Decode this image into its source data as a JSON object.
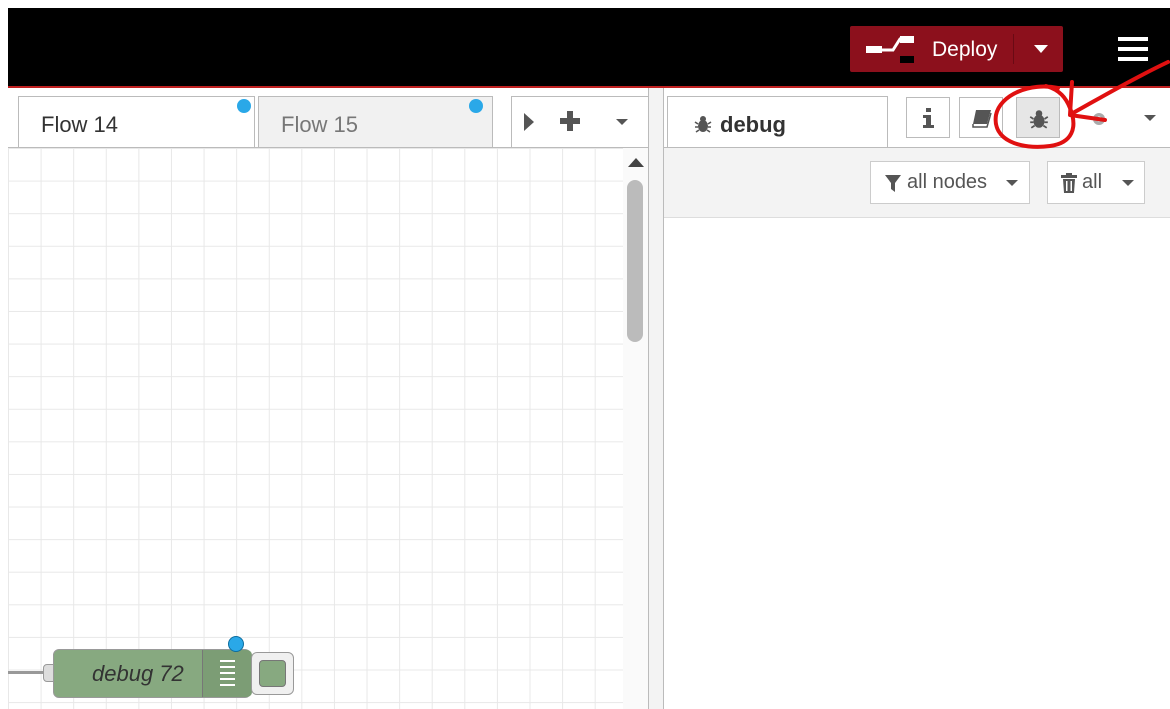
{
  "header": {
    "deploy_label": "Deploy",
    "icons": [
      "deploy-icon",
      "caret-down-icon",
      "menu-icon"
    ]
  },
  "workspace": {
    "tabs": [
      {
        "label": "Flow 14",
        "active": true,
        "changed": true
      },
      {
        "label": "Flow 15",
        "active": false,
        "changed": true
      }
    ],
    "tab_tools": [
      "play-icon",
      "plus-icon",
      "caret-down-icon"
    ]
  },
  "canvas": {
    "node": {
      "label": "debug 72",
      "changed": true,
      "color": "#87a980"
    }
  },
  "sidebar": {
    "active_tab_label": "debug",
    "tab_buttons": [
      "info-icon",
      "help-book-icon",
      "bug-icon",
      "gear-icon",
      "caret-down-icon"
    ],
    "filter_label": "all nodes",
    "clear_label": "all"
  },
  "colors": {
    "header_bg": "#000000",
    "deploy_bg": "#8c101c",
    "changed_dot": "#2aa8e8",
    "annotation": "#e01010"
  }
}
